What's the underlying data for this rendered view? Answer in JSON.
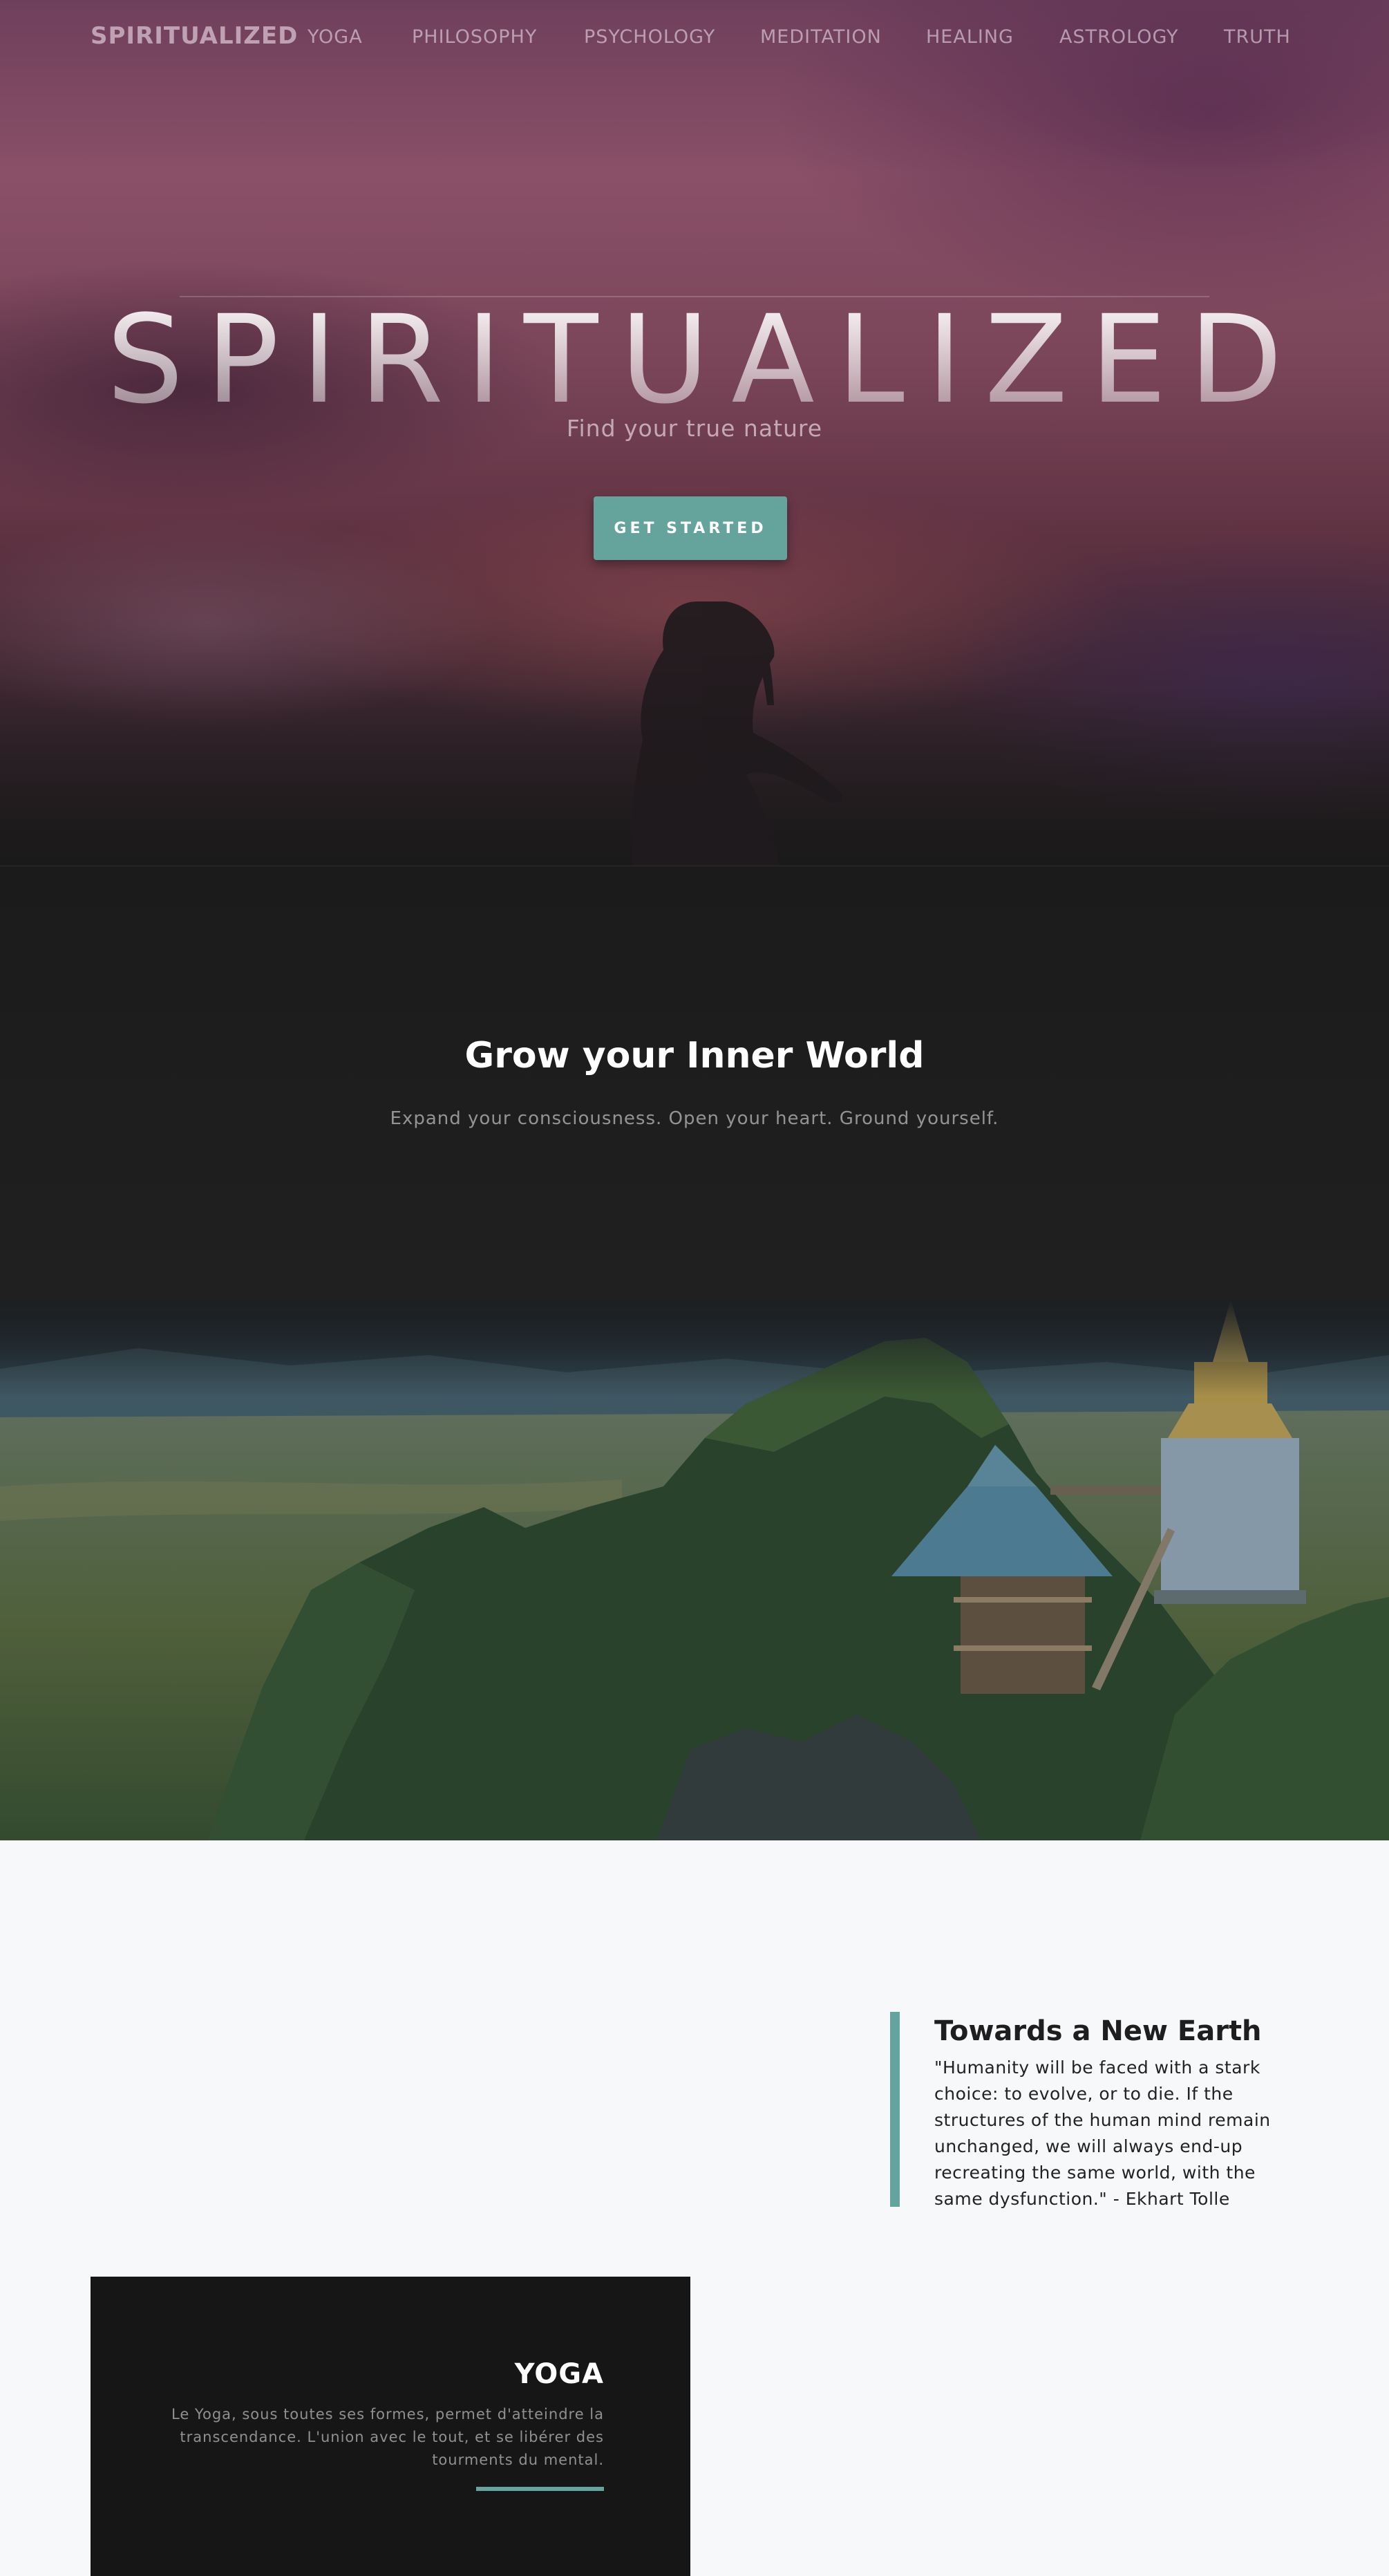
{
  "nav": {
    "brand": "SPIRITUALIZED",
    "links": [
      "YOGA",
      "PHILOSOPHY",
      "PSYCHOLOGY",
      "MEDITATION",
      "HEALING",
      "ASTROLOGY",
      "TRUTH"
    ]
  },
  "hero": {
    "title": "SPIRITUALIZED",
    "subtitle": "Find your true nature",
    "cta_label": "GET STARTED"
  },
  "about": {
    "title": "Grow your Inner World",
    "text": "Expand your consciousness. Open your heart. Ground yourself."
  },
  "featured": {
    "title": "Towards a New Earth",
    "quote": "\"Humanity will be faced with a stark choice: to evolve, or to die. If the structures of the human mind remain unchanged, we will always end-up recreating the same world, with the same dysfunction.\" - Ekhart Tolle"
  },
  "yoga": {
    "title": "YOGA",
    "text": "Le Yoga, sous toutes ses formes, permet d'atteindre la transcendance. L'union avec le tout, et se libérer des tourments du mental."
  },
  "colors": {
    "accent": "#65a49c",
    "dark_section": "#1b1b1b",
    "card": "#161616",
    "page_bg": "#f7f8fa"
  }
}
